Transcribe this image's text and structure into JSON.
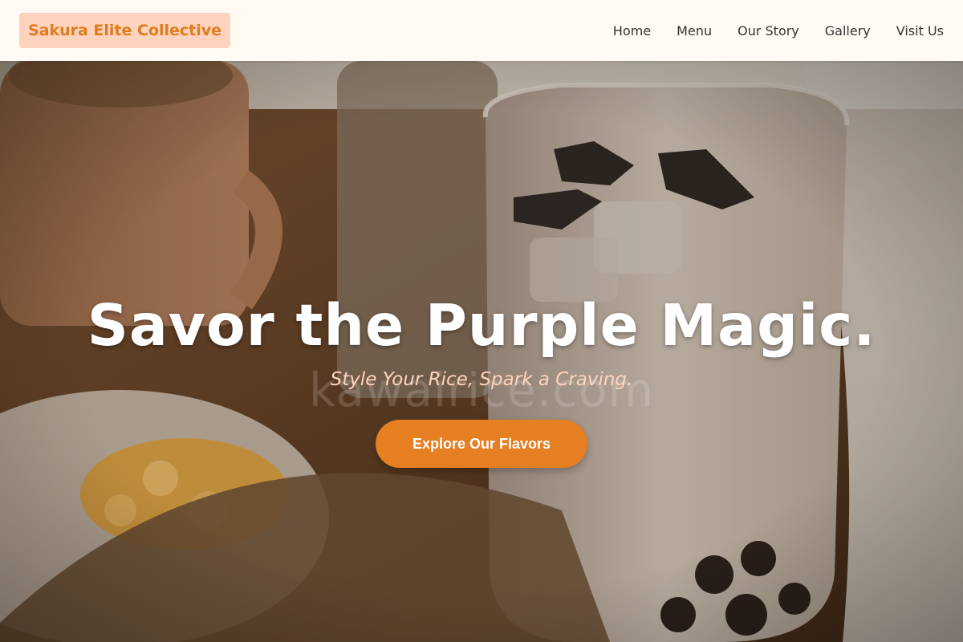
{
  "header": {
    "brand": "Sakura Elite Collective",
    "nav": [
      {
        "label": "Home"
      },
      {
        "label": "Menu"
      },
      {
        "label": "Our Story"
      },
      {
        "label": "Gallery"
      },
      {
        "label": "Visit Us"
      }
    ]
  },
  "hero": {
    "title": "Savor the Purple Magic.",
    "subtitle": "Style Your Rice, Spark a Craving.",
    "watermark": "kawairice.com",
    "cta_label": "Explore Our Flavors"
  },
  "colors": {
    "accent": "#e67e22",
    "brand_bg": "#fdd3bd",
    "brand_text": "#e07b1f",
    "header_bg": "#fffaf3",
    "subtitle": "#ffd4bd"
  }
}
